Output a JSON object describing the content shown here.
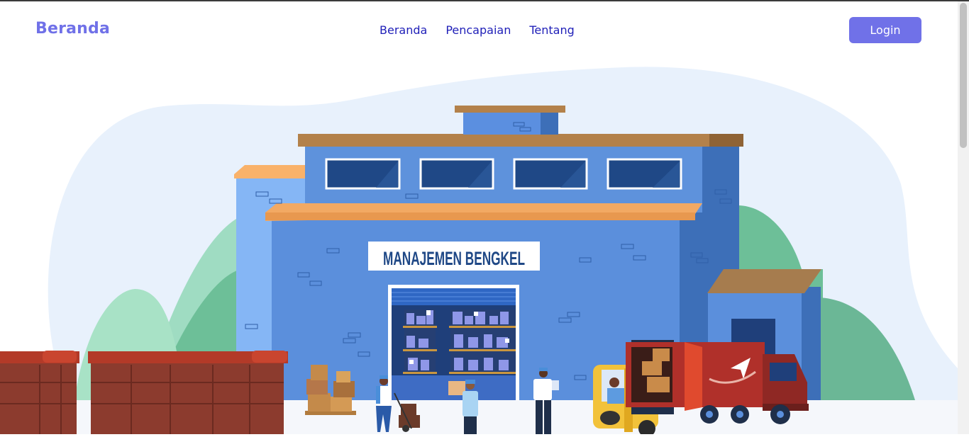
{
  "navbar": {
    "brand": "Beranda",
    "links": [
      "Beranda",
      "Pencapaian",
      "Tentang"
    ],
    "login_label": "Login"
  },
  "hero": {
    "sign_text": "MANAJEMEN BENGKEL",
    "illustration_icon": "warehouse-illustration"
  },
  "colors": {
    "accent": "#7071e8",
    "nav_link": "#1f1fb8",
    "building": "#5b8fd9",
    "background_blob": "#e8f1fc"
  }
}
